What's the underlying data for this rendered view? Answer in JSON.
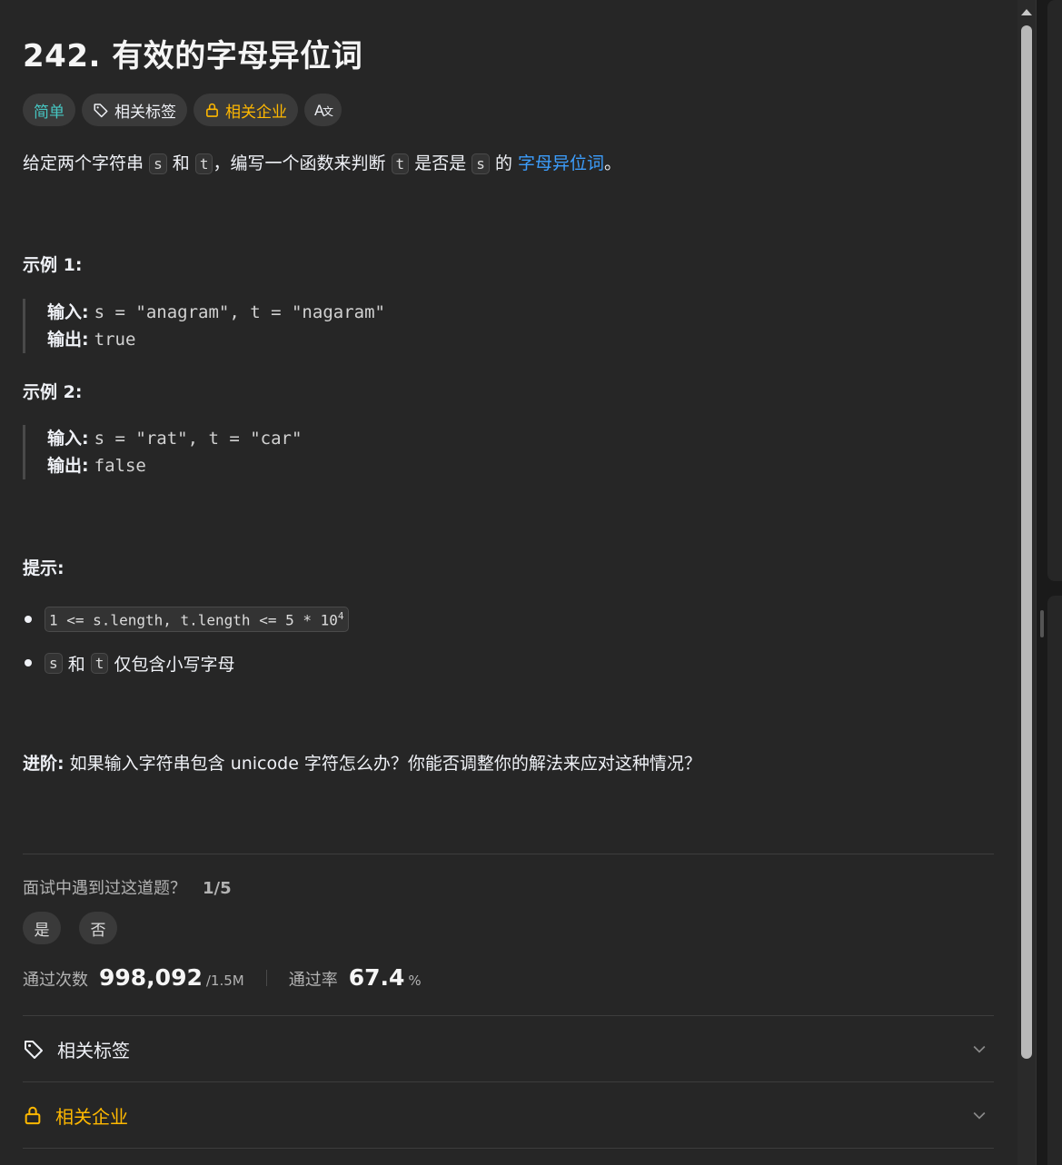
{
  "problem": {
    "title": "242. 有效的字母异位词"
  },
  "tags": {
    "difficulty": "简单",
    "topics": "相关标签",
    "companies": "相关企业",
    "translate_icon_text": "A文"
  },
  "description": {
    "p1": "给定两个字符串",
    "s": "s",
    "and": "和",
    "t": "t",
    "p2": "，编写一个函数来判断",
    "p3": "是否是",
    "p4": "的",
    "link": "字母异位词",
    "end": "。"
  },
  "examples": [
    {
      "heading": "示例 1:",
      "input_label": "输入:",
      "input_value": "s = \"anagram\", t = \"nagaram\"",
      "output_label": "输出:",
      "output_value": "true"
    },
    {
      "heading": "示例 2:",
      "input_label": "输入:",
      "input_value": "s = \"rat\", t = \"car\"",
      "output_label": "输出:",
      "output_value": "false"
    }
  ],
  "hints": {
    "heading": "提示:",
    "c1": "1 <= s.length, t.length <= 5 * 10",
    "c1_exp": "4",
    "c2_s": "s",
    "c2_and": "和",
    "c2_t": "t",
    "c2_rest": "仅包含小写字母"
  },
  "advance": {
    "label": "进阶:",
    "text": "如果输入字符串包含 unicode 字符怎么办？你能否调整你的解法来应对这种情况？"
  },
  "interview": {
    "question": "面试中遇到过这道题？",
    "count": "1/5",
    "yes": "是",
    "no": "否"
  },
  "stats": {
    "accepted_label": "通过次数",
    "accepted_value": "998,092",
    "submissions": "/1.5M",
    "rate_label": "通过率",
    "rate_value": "67.4",
    "rate_unit": "%"
  },
  "sections": {
    "topics": "相关标签",
    "companies": "相关企业"
  },
  "colors": {
    "easy": "#46c6c2",
    "company": "#ffb800",
    "link": "#3c9dfc"
  }
}
